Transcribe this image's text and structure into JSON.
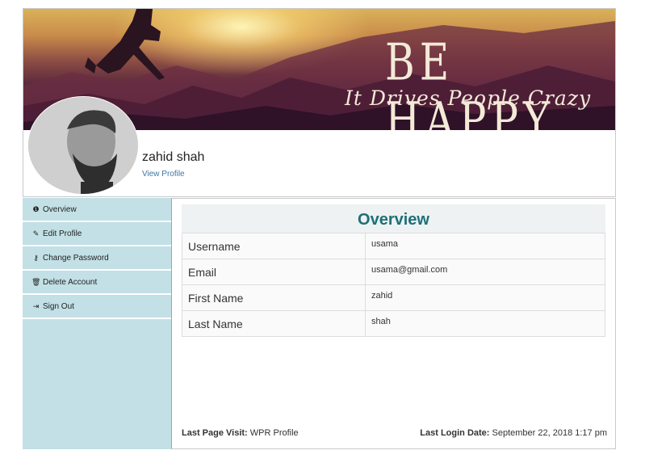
{
  "cover": {
    "title": "BE HAPPY",
    "tagline": "It Drives People Crazy"
  },
  "profile": {
    "name": "zahid shah",
    "view_profile": "View Profile"
  },
  "sidebar": {
    "items": [
      {
        "label": "Overview",
        "icon": "info-circle-icon",
        "glyph": "❶"
      },
      {
        "label": "Edit Profile",
        "icon": "edit-icon",
        "glyph": "✎"
      },
      {
        "label": "Change Password",
        "icon": "key-icon",
        "glyph": "⚷"
      },
      {
        "label": "Delete Account",
        "icon": "trash-icon",
        "glyph": "🗑"
      },
      {
        "label": "Sign Out",
        "icon": "sign-out-icon",
        "glyph": "⇥"
      }
    ]
  },
  "overview": {
    "heading": "Overview",
    "rows": [
      {
        "label": "Username",
        "value": "usama"
      },
      {
        "label": "Email",
        "value": "usama@gmail.com"
      },
      {
        "label": "First Name",
        "value": "zahid"
      },
      {
        "label": "Last Name",
        "value": "shah"
      }
    ]
  },
  "footer": {
    "last_visit_label": "Last Page Visit:",
    "last_visit_value": "WPR Profile",
    "last_login_label": "Last Login Date:",
    "last_login_value": "September 22, 2018 1:17 pm"
  },
  "colors": {
    "sidebar_bg": "#c2e0e6",
    "heading_text": "#1f6f78",
    "link": "#3a78a5"
  }
}
